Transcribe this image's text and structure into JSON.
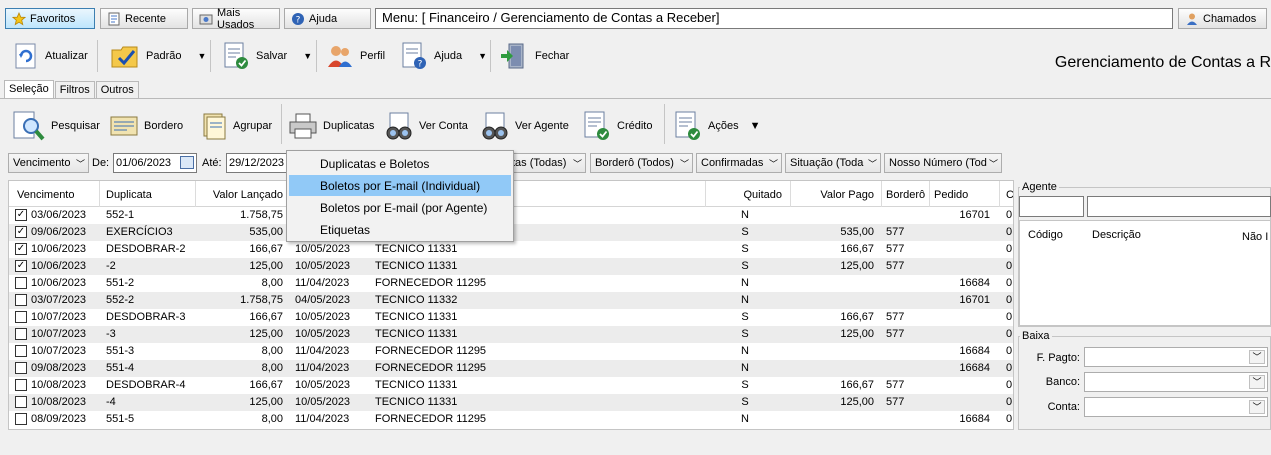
{
  "quickbar": {
    "favoritos": "Favoritos",
    "recente": "Recente",
    "mais_usados": "Mais Usados",
    "ajuda": "Ajuda",
    "menu_path": "Menu: [ Financeiro / Gerenciamento de Contas a Receber]",
    "chamados": "Chamados"
  },
  "toolbar": {
    "atualizar": "Atualizar",
    "padrao": "Padrão",
    "salvar": "Salvar",
    "perfil": "Perfil",
    "ajuda": "Ajuda",
    "fechar": "Fechar"
  },
  "page_title": "Gerenciamento de Contas a R",
  "tabs": [
    {
      "label": "Seleção",
      "active": true
    },
    {
      "label": "Filtros",
      "active": false
    },
    {
      "label": "Outros",
      "active": false
    }
  ],
  "actions": {
    "pesquisar": "Pesquisar",
    "bordero": "Bordero",
    "agrupar": "Agrupar",
    "duplicatas": "Duplicatas",
    "ver_conta": "Ver Conta",
    "ver_agente": "Ver Agente",
    "credito": "Crédito",
    "acoes": "Ações"
  },
  "filters": {
    "vencimento": "Vencimento",
    "de_label": "De:",
    "de_value": "01/06/2023",
    "ate_label": "Até:",
    "ate_value": "29/12/2023",
    "tipo": "tas (Todas)",
    "bordero": "Borderô (Todos)",
    "confirmadas": "Confirmadas",
    "situacao": "Situação (Toda",
    "nosso_numero": "Nosso Número (Tod"
  },
  "dropdown": {
    "items": [
      "Duplicatas e Boletos",
      "Boletos por E-mail (Individual)",
      "Boletos por E-mail (por Agente)",
      "Etiquetas"
    ],
    "highlighted": 1
  },
  "grid": {
    "columns": [
      "Vencimento",
      "Duplicata",
      "Valor Lançado",
      "Quitado",
      "Valor Pago",
      "Borderô",
      "Pedido",
      "C"
    ],
    "rows": [
      {
        "checked": true,
        "vencimento": "03/06/2023",
        "duplicata": "552-1",
        "valor": "1.758,75",
        "data": "",
        "agente": "",
        "quitado": "N",
        "pago": "",
        "bordero": "",
        "pedido": "16701",
        "c": "0"
      },
      {
        "checked": true,
        "vencimento": "09/06/2023",
        "duplicata": "EXERCÍCIO3",
        "valor": "535,00",
        "data": "",
        "agente": "",
        "quitado": "S",
        "pago": "535,00",
        "bordero": "577",
        "pedido": "",
        "c": "0"
      },
      {
        "checked": true,
        "vencimento": "10/06/2023",
        "duplicata": "DESDOBRAR-2",
        "valor": "166,67",
        "data": "10/05/2023",
        "agente": "TECNICO 11331",
        "quitado": "S",
        "pago": "166,67",
        "bordero": "577",
        "pedido": "",
        "c": "0"
      },
      {
        "checked": true,
        "vencimento": "10/06/2023",
        "duplicata": "-2",
        "valor": "125,00",
        "data": "10/05/2023",
        "agente": "TECNICO 11331",
        "quitado": "S",
        "pago": "125,00",
        "bordero": "577",
        "pedido": "",
        "c": "0"
      },
      {
        "checked": false,
        "vencimento": "10/06/2023",
        "duplicata": "551-2",
        "valor": "8,00",
        "data": "11/04/2023",
        "agente": "FORNECEDOR 11295",
        "quitado": "N",
        "pago": "",
        "bordero": "",
        "pedido": "16684",
        "c": "0"
      },
      {
        "checked": false,
        "vencimento": "03/07/2023",
        "duplicata": "552-2",
        "valor": "1.758,75",
        "data": "04/05/2023",
        "agente": "TECNICO 11332",
        "quitado": "N",
        "pago": "",
        "bordero": "",
        "pedido": "16701",
        "c": "0"
      },
      {
        "checked": false,
        "vencimento": "10/07/2023",
        "duplicata": "DESDOBRAR-3",
        "valor": "166,67",
        "data": "10/05/2023",
        "agente": "TECNICO 11331",
        "quitado": "S",
        "pago": "166,67",
        "bordero": "577",
        "pedido": "",
        "c": "0"
      },
      {
        "checked": false,
        "vencimento": "10/07/2023",
        "duplicata": "-3",
        "valor": "125,00",
        "data": "10/05/2023",
        "agente": "TECNICO 11331",
        "quitado": "S",
        "pago": "125,00",
        "bordero": "577",
        "pedido": "",
        "c": "0"
      },
      {
        "checked": false,
        "vencimento": "10/07/2023",
        "duplicata": "551-3",
        "valor": "8,00",
        "data": "11/04/2023",
        "agente": "FORNECEDOR 11295",
        "quitado": "N",
        "pago": "",
        "bordero": "",
        "pedido": "16684",
        "c": "0"
      },
      {
        "checked": false,
        "vencimento": "09/08/2023",
        "duplicata": "551-4",
        "valor": "8,00",
        "data": "11/04/2023",
        "agente": "FORNECEDOR 11295",
        "quitado": "N",
        "pago": "",
        "bordero": "",
        "pedido": "16684",
        "c": "0"
      },
      {
        "checked": false,
        "vencimento": "10/08/2023",
        "duplicata": "DESDOBRAR-4",
        "valor": "166,67",
        "data": "10/05/2023",
        "agente": "TECNICO 11331",
        "quitado": "S",
        "pago": "166,67",
        "bordero": "577",
        "pedido": "",
        "c": "0"
      },
      {
        "checked": false,
        "vencimento": "10/08/2023",
        "duplicata": "-4",
        "valor": "125,00",
        "data": "10/05/2023",
        "agente": "TECNICO 11331",
        "quitado": "S",
        "pago": "125,00",
        "bordero": "577",
        "pedido": "",
        "c": "0"
      },
      {
        "checked": false,
        "vencimento": "08/09/2023",
        "duplicata": "551-5",
        "valor": "8,00",
        "data": "11/04/2023",
        "agente": "FORNECEDOR 11295",
        "quitado": "N",
        "pago": "",
        "bordero": "",
        "pedido": "16684",
        "c": "0"
      }
    ]
  },
  "right_panel": {
    "agente_title": "Agente",
    "codigo_header": "Código",
    "descricao_header": "Descrição",
    "nao_header": "Não I",
    "baixa_title": "Baixa",
    "f_pagto": "F. Pagto:",
    "banco": "Banco:",
    "conta": "Conta:"
  },
  "colors": {
    "highlight": "#91c9f7",
    "alt_row": "#ececec",
    "background": "#f0f0f0"
  }
}
